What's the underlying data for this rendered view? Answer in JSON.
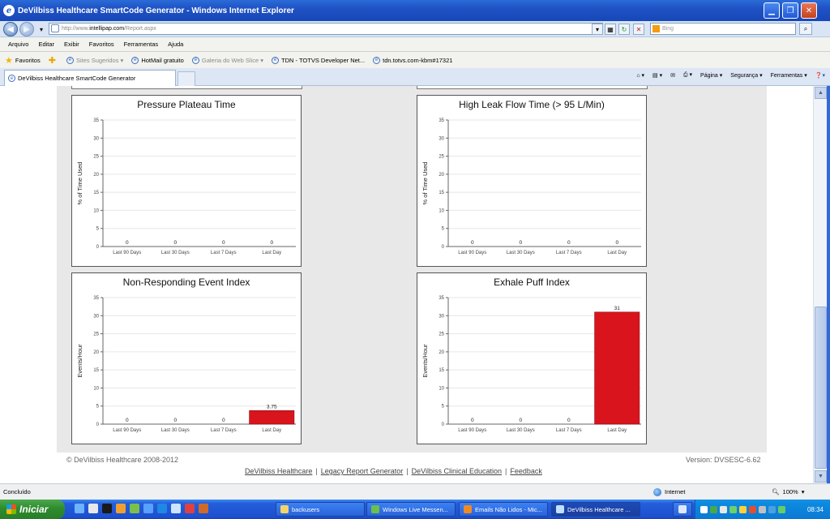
{
  "window": {
    "title": "DeVilbiss Healthcare SmartCode Generator - Windows Internet Explorer"
  },
  "address": {
    "url_prefix": "http://www.",
    "url_domain": "intellipap.com",
    "url_path": "/Report.aspx",
    "search_placeholder": "Bing"
  },
  "menu": [
    "Arquivo",
    "Editar",
    "Exibir",
    "Favoritos",
    "Ferramentas",
    "Ajuda"
  ],
  "favorites": {
    "label": "Favoritos",
    "items": [
      {
        "label": "Sites Sugeridos ▾",
        "dim": true
      },
      {
        "label": "HotMail gratuito",
        "dim": false
      },
      {
        "label": "Galeria do Web Slice ▾",
        "dim": true
      },
      {
        "label": "TDN - TOTVS Developer Net...",
        "dim": false
      },
      {
        "label": "tdn.totvs.com-kbm#17321",
        "dim": false
      }
    ]
  },
  "tab": {
    "label": "DeVilbiss Healthcare SmartCode Generator"
  },
  "commandbar": {
    "page": "Página ▾",
    "safety": "Segurança ▾",
    "tools": "Ferramentas ▾"
  },
  "chart_data": [
    {
      "type": "bar",
      "title": "Pressure Plateau Time",
      "ylabel": "% of Time Used",
      "categories": [
        "Last 90 Days",
        "Last 30 Days",
        "Last 7 Days",
        "Last Day"
      ],
      "values": [
        0,
        0,
        0,
        0
      ],
      "labels": [
        "0",
        "0",
        "0",
        "0"
      ],
      "ylim": [
        0,
        35
      ],
      "yticks": [
        0,
        5,
        10,
        15,
        20,
        25,
        30,
        35
      ]
    },
    {
      "type": "bar",
      "title": "High Leak Flow Time (> 95 L/Min)",
      "ylabel": "% of Time Used",
      "categories": [
        "Last 90 Days",
        "Last 30 Days",
        "Last 7 Days",
        "Last Day"
      ],
      "values": [
        0,
        0,
        0,
        0
      ],
      "labels": [
        "0",
        "0",
        "0",
        "0"
      ],
      "ylim": [
        0,
        35
      ],
      "yticks": [
        0,
        5,
        10,
        15,
        20,
        25,
        30,
        35
      ]
    },
    {
      "type": "bar",
      "title": "Non-Responding Event Index",
      "ylabel": "Events/Hour",
      "categories": [
        "Last 90 Days",
        "Last 30 Days",
        "Last 7 Days",
        "Last Day"
      ],
      "values": [
        0,
        0,
        0,
        3.75
      ],
      "labels": [
        "0",
        "0",
        "0",
        "3.75"
      ],
      "ylim": [
        0,
        35
      ],
      "yticks": [
        0,
        5,
        10,
        15,
        20,
        25,
        30,
        35
      ]
    },
    {
      "type": "bar",
      "title": "Exhale Puff Index",
      "ylabel": "Events/Hour",
      "categories": [
        "Last 90 Days",
        "Last 30 Days",
        "Last 7 Days",
        "Last Day"
      ],
      "values": [
        0,
        0,
        0,
        31
      ],
      "labels": [
        "0",
        "0",
        "0",
        "31"
      ],
      "ylim": [
        0,
        35
      ],
      "yticks": [
        0,
        5,
        10,
        15,
        20,
        25,
        30,
        35
      ]
    }
  ],
  "footer": {
    "copyright": "© DeVilbiss Healthcare 2008-2012",
    "version": "Version: DVSESC-6.62",
    "links": [
      "DeVilbiss Healthcare",
      "Legacy Report Generator",
      "DeVilbiss Clinical Education",
      "Feedback"
    ]
  },
  "status": {
    "left": "Concluído",
    "zone": "Internet",
    "zoom": "100%"
  },
  "taskbar": {
    "start": "Iniciar",
    "buttons": [
      "backusers",
      "Windows Live Messen...",
      "Emails Não Lidos - Mic...",
      "DeVilbiss Healthcare ..."
    ],
    "clock": "08:34"
  },
  "colors": {
    "bar": "#d9141c",
    "titlebar": "#1f52c4",
    "taskbar": "#245edb"
  }
}
